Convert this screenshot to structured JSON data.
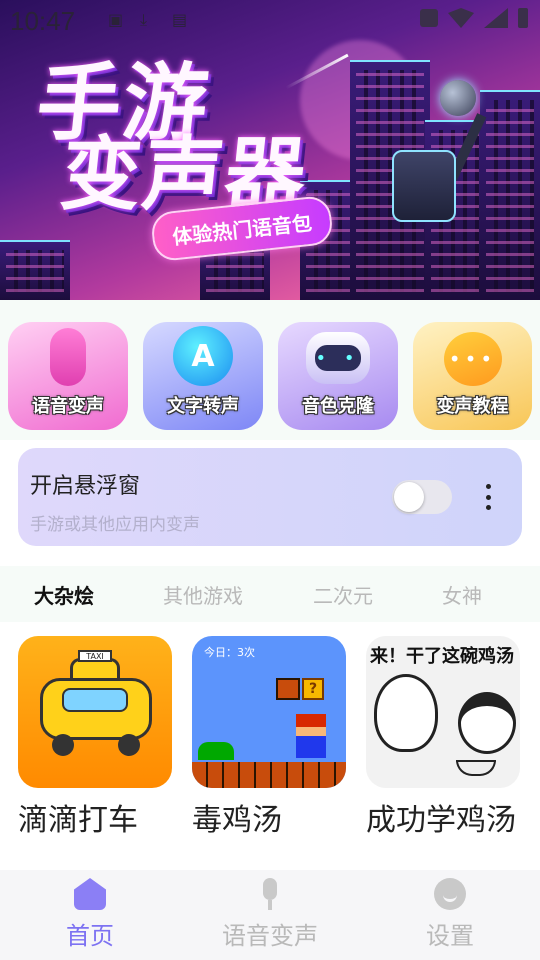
{
  "status_bar": {
    "time": "10:47"
  },
  "banner": {
    "title_line1": "手游",
    "title_line2": "变声器",
    "subtitle": "体验热门语音包"
  },
  "features": [
    {
      "label": "语音变声",
      "icon": "microphone-icon"
    },
    {
      "label": "文字转声",
      "icon": "letter-a-icon"
    },
    {
      "label": "音色克隆",
      "icon": "robot-icon"
    },
    {
      "label": "变声教程",
      "icon": "chat-bubble-icon"
    }
  ],
  "floating_window": {
    "title": "开启悬浮窗",
    "subtitle": "手游或其他应用内变声",
    "toggle_on": false
  },
  "tabs": [
    {
      "label": "大杂烩",
      "active": true
    },
    {
      "label": "其他游戏",
      "active": false
    },
    {
      "label": "二次元",
      "active": false
    },
    {
      "label": "女神",
      "active": false
    }
  ],
  "items": [
    {
      "title": "滴滴打车",
      "thumb": "taxi-icon",
      "thumb_text": "TAXI"
    },
    {
      "title": "毒鸡汤",
      "thumb": "mario-game-icon",
      "thumb_text": "今日：3次"
    },
    {
      "title": "成功学鸡汤",
      "thumb": "meme-icon",
      "thumb_text": "来！干了这碗鸡汤"
    }
  ],
  "bottom_nav": [
    {
      "label": "首页",
      "icon": "home-icon",
      "active": true
    },
    {
      "label": "语音变声",
      "icon": "microphone-icon",
      "active": false
    },
    {
      "label": "设置",
      "icon": "smile-icon",
      "active": false
    }
  ],
  "colors": {
    "accent": "#7d72f2",
    "inactive": "#b9b9b9"
  }
}
